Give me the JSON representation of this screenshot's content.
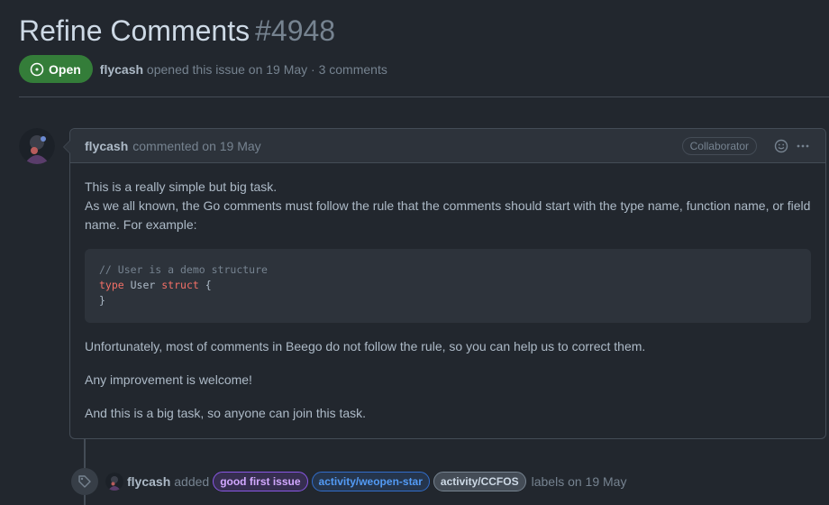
{
  "issue": {
    "title": "Refine Comments",
    "number": "#4948",
    "state": "Open",
    "author": "flycash",
    "meta": "opened this issue on 19 May · 3 comments"
  },
  "comment": {
    "author": "flycash",
    "timestamp": "commented on 19 May",
    "role_badge": "Collaborator",
    "body": {
      "line1": "This is a really simple but big task.",
      "line2": "As we all known, the Go comments must follow the rule that the comments should start with the type name, function name, or field name. For example:",
      "code": {
        "comment_line": "// User is a demo structure",
        "kw_type": "type",
        "ident": " User ",
        "kw_struct": "struct",
        "brace_open": " {",
        "brace_close": "}"
      },
      "para2": "Unfortunately, most of comments in Beego do not follow the rule, so you can help us to correct them.",
      "para3": "Any improvement is welcome!",
      "para4": "And this is a big task, so anyone can join this task."
    }
  },
  "event": {
    "author": "flycash",
    "verb": "added",
    "labels": [
      "good first issue",
      "activity/weopen-star",
      "activity/CCFOS"
    ],
    "tail": "labels on 19 May"
  },
  "colors": {
    "open_green": "#347d39",
    "background": "#22272e",
    "border": "#444c56"
  },
  "icons": {
    "state": "issue-opened-icon",
    "reaction": "smiley-icon",
    "more": "kebab-horizontal-icon",
    "event": "tag-icon"
  }
}
